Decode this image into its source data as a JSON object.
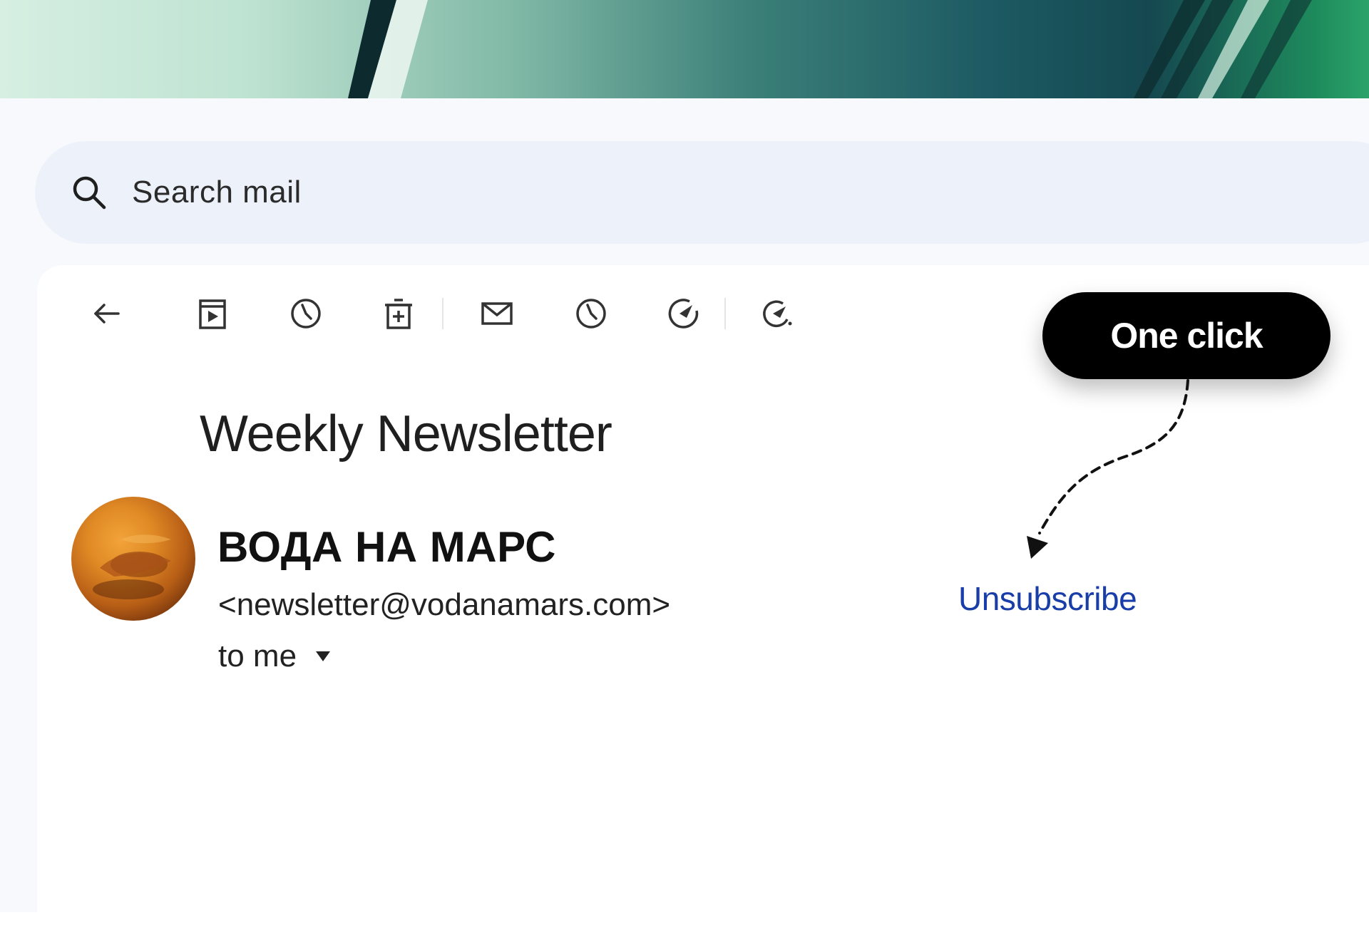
{
  "search": {
    "placeholder": "Search mail"
  },
  "toolbar": {
    "buttons": [
      {
        "name": "back",
        "icon": "arrow-left-icon"
      },
      {
        "name": "archive",
        "icon": "archive-icon"
      },
      {
        "name": "snooze",
        "icon": "clock-icon"
      },
      {
        "name": "delete",
        "icon": "trash-icon"
      },
      {
        "name": "mark-unread",
        "icon": "envelope-icon"
      },
      {
        "name": "snooze-alt",
        "icon": "clock-icon"
      },
      {
        "name": "add-to-tasks",
        "icon": "task-check-icon"
      },
      {
        "name": "more-actions",
        "icon": "task-add-icon"
      }
    ]
  },
  "annotation": {
    "label": "One click"
  },
  "email": {
    "subject": "Weekly Newsletter",
    "sender_name": "ВОДА НА МАРС",
    "sender_email": "<newsletter@vodanamars.com>",
    "recipient": "to me",
    "unsubscribe_label": "Unsubscribe"
  },
  "colors": {
    "banner_start": "#d6efe2",
    "banner_end": "#2aa36a",
    "search_bg": "#edf2fa",
    "link": "#1a3ea8",
    "pill_bg": "#000000"
  }
}
